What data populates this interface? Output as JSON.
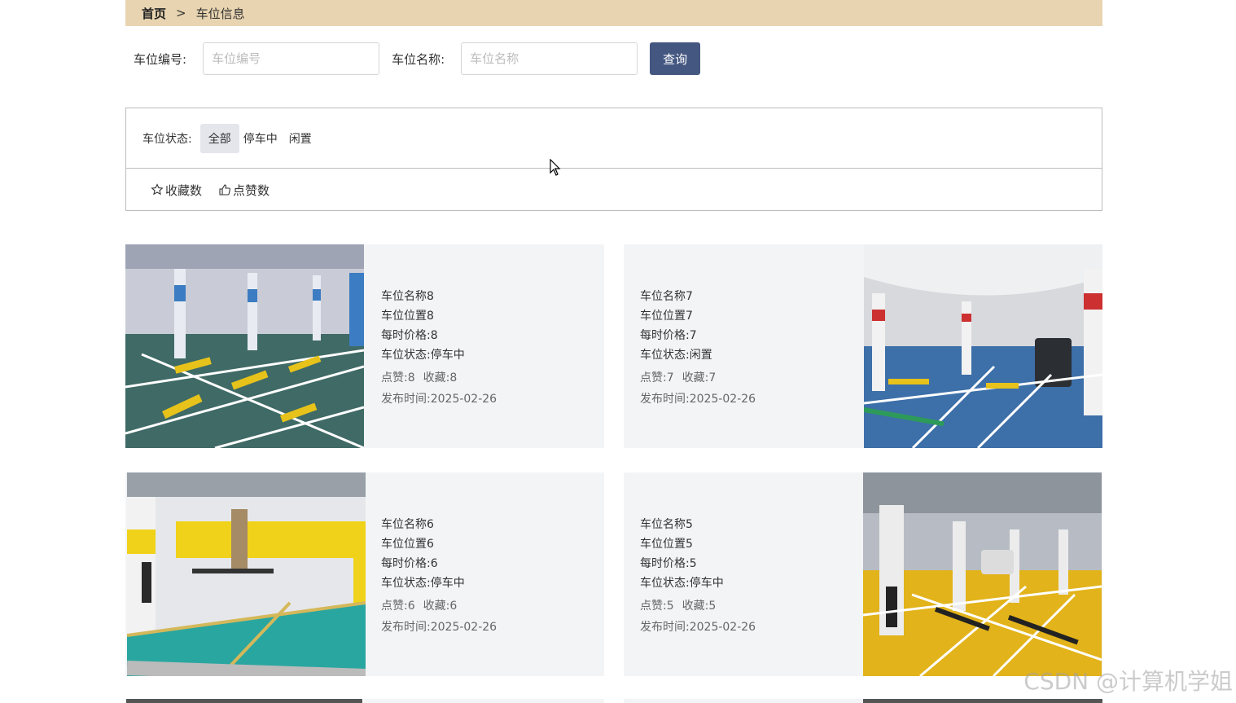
{
  "breadcrumb": {
    "home": "首页",
    "sep": ">",
    "current": "车位信息"
  },
  "search": {
    "number_label": "车位编号:",
    "number_placeholder": "车位编号",
    "name_label": "车位名称:",
    "name_placeholder": "车位名称",
    "button": "查询"
  },
  "filter": {
    "label": "车位状态:",
    "options": [
      "全部",
      "停车中",
      "闲置"
    ],
    "selected": "全部"
  },
  "sort": {
    "favorites": "收藏数",
    "likes": "点赞数"
  },
  "cards": [
    {
      "name": "车位名称8",
      "location": "车位位置8",
      "price": "每时价格:8",
      "status": "车位状态:停车中",
      "likes": "点赞:8",
      "favorites": "收藏:8",
      "published": "发布时间:2025-02-26",
      "image": "parking-garage-photo"
    },
    {
      "name": "车位名称7",
      "location": "车位位置7",
      "price": "每时价格:7",
      "status": "车位状态:闲置",
      "likes": "点赞:7",
      "favorites": "收藏:7",
      "published": "发布时间:2025-02-26",
      "image": "parking-garage-photo"
    },
    {
      "name": "车位名称6",
      "location": "车位位置6",
      "price": "每时价格:6",
      "status": "车位状态:停车中",
      "likes": "点赞:6",
      "favorites": "收藏:6",
      "published": "发布时间:2025-02-26",
      "image": "parking-garage-photo"
    },
    {
      "name": "车位名称5",
      "location": "车位位置5",
      "price": "每时价格:5",
      "status": "车位状态:停车中",
      "likes": "点赞:5",
      "favorites": "收藏:5",
      "published": "发布时间:2025-02-26",
      "image": "parking-garage-photo"
    }
  ],
  "watermark": "CSDN @计算机学姐",
  "colors": {
    "breadcrumb_bg": "#e8d4b0",
    "button_bg": "#445781",
    "card_bg": "#f3f4f6"
  }
}
